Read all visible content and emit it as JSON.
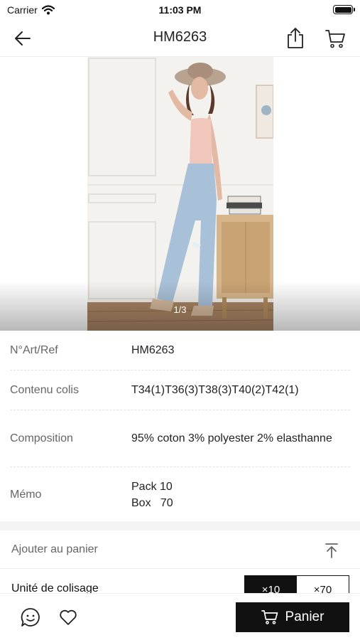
{
  "status_bar": {
    "carrier": "Carrier",
    "time": "11:03 PM",
    "icons": [
      "wifi-icon",
      "battery-icon"
    ]
  },
  "nav": {
    "title": "HM6263",
    "icons": [
      "back-arrow-icon",
      "share-icon",
      "cart-icon"
    ]
  },
  "gallery": {
    "pager": "1/3",
    "current": 1,
    "total": 3
  },
  "details": [
    {
      "label": "N°Art/Ref",
      "value": "HM6263"
    },
    {
      "label": "Contenu colis",
      "value": "T34(1)T36(3)T38(3)T40(2)T42(1)"
    },
    {
      "label": "Composition",
      "value": "95% coton 3% polyester 2% elasthanne"
    },
    {
      "label": "Mémo",
      "value_lines": [
        "Pack 10",
        "Box   70"
      ]
    }
  ],
  "add_to_cart": {
    "title": "Ajouter au panier",
    "unit_label": "Unité de colisage",
    "unit_options": [
      "×10",
      "×70"
    ],
    "selected_unit": "×10"
  },
  "bottom_bar": {
    "panier_label": "Panier",
    "icons": [
      "chat-icon",
      "heart-icon",
      "cart-icon"
    ]
  },
  "colors": {
    "primary": "#111111",
    "label": "#666666",
    "separator": "#e2e2e2"
  }
}
